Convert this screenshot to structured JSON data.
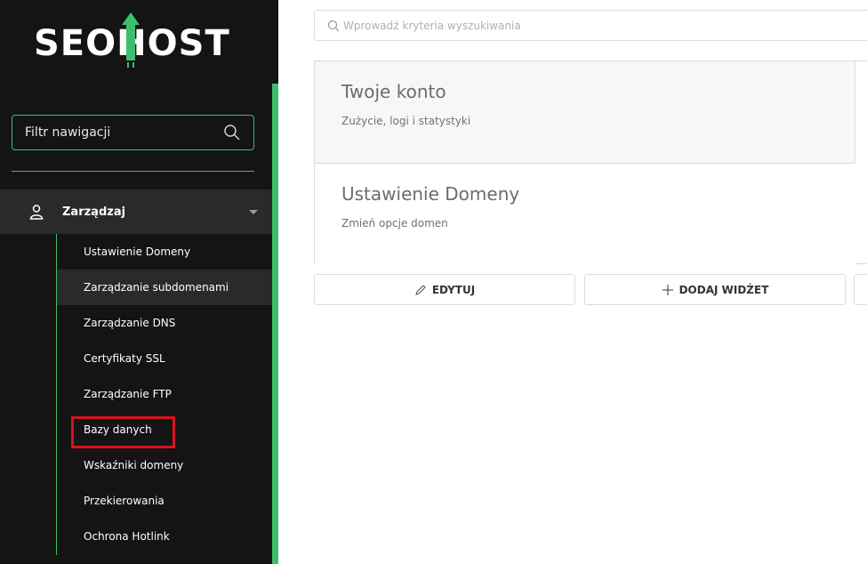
{
  "brand": {
    "logo_text_left": "SEO",
    "logo_text_h": "H",
    "logo_text_right": "OST",
    "accent_color": "#3dbe6e"
  },
  "sidebar": {
    "filter_placeholder": "Filtr nawigacji",
    "group": {
      "label": "Zarządzaj",
      "icon": "user-icon"
    },
    "items": [
      {
        "label": "Ustawienie Domeny"
      },
      {
        "label": "Zarządzanie subdomenami"
      },
      {
        "label": "Zarządzanie DNS"
      },
      {
        "label": "Certyfikaty SSL"
      },
      {
        "label": "Zarządzanie FTP"
      },
      {
        "label": "Bazy danych"
      },
      {
        "label": "Wskaźniki domeny"
      },
      {
        "label": "Przekierowania"
      },
      {
        "label": "Ochrona Hotlink"
      }
    ],
    "active_index": 1,
    "highlighted_index": 5
  },
  "main": {
    "search_placeholder": "Wprowadź kryteria wyszukiwania",
    "widgets": [
      {
        "title": "Twoje konto",
        "subtitle": "Zużycie, logi i statystyki"
      },
      {
        "title": "Ustawienie Domeny",
        "subtitle": "Zmień opcje domen"
      }
    ],
    "buttons": {
      "edit_label": "EDYTUJ",
      "add_widget_label": "DODAJ WIDŻET"
    }
  }
}
